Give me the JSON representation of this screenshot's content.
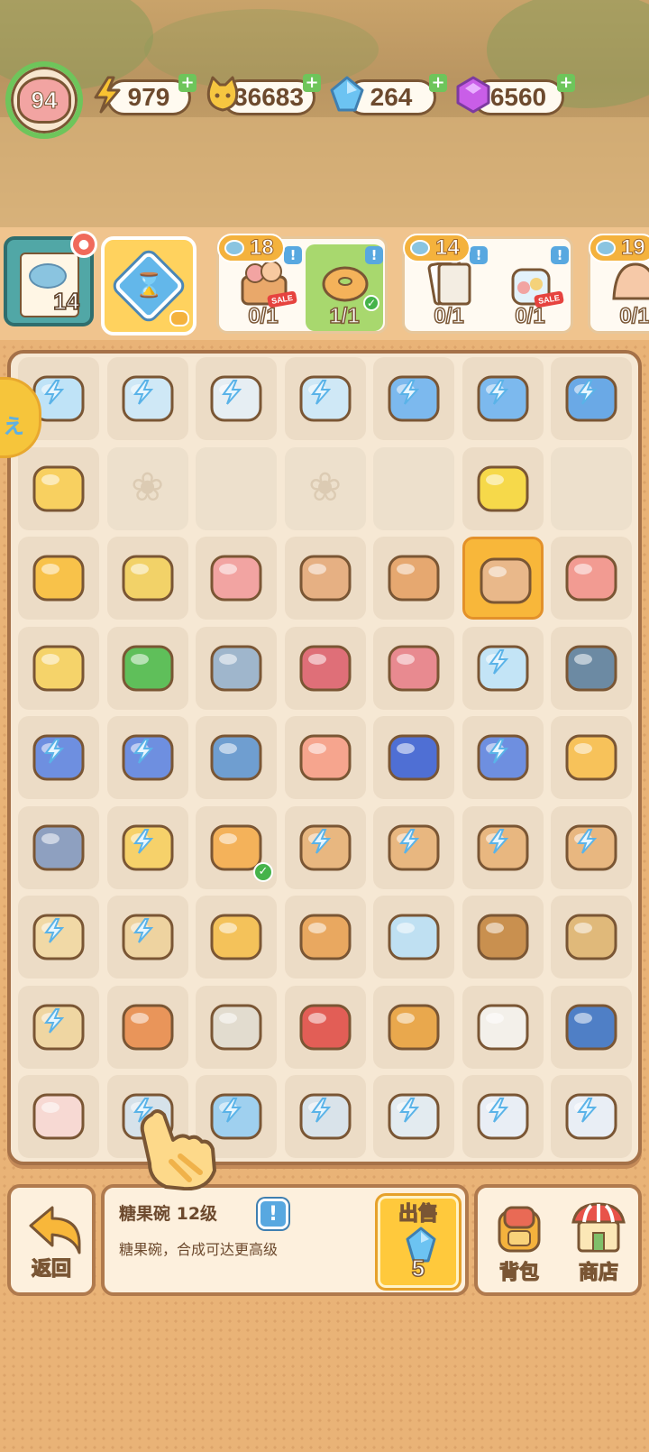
{
  "resources": {
    "level": "94",
    "energy": "979",
    "coins": "36683",
    "gems": "264",
    "crystals": "6560"
  },
  "order_book": {
    "count": "14"
  },
  "orders": [
    {
      "reward": "18",
      "slots": [
        {
          "count": "0/1",
          "item": "gift-basket",
          "sale": "SALE"
        },
        {
          "count": "1/1",
          "item": "donut",
          "done": true
        }
      ]
    },
    {
      "reward": "14",
      "slots": [
        {
          "count": "0/1",
          "item": "papers"
        },
        {
          "count": "0/1",
          "item": "candy-jar",
          "sale": "SALE"
        }
      ]
    },
    {
      "reward": "19",
      "slots": [
        {
          "count": "0/1",
          "item": "shell"
        }
      ]
    }
  ],
  "board": {
    "rows": [
      [
        "ice-cube",
        "open-fridge",
        "scale",
        "freezer",
        "toaster",
        "toaster",
        "open-toaster"
      ],
      [
        "gift-box",
        "empty",
        "empty",
        "empty",
        "empty",
        "lemons",
        "empty"
      ],
      [
        "orange-juice",
        "cat-cookies",
        "candy",
        "handbag",
        "purse",
        "candy-bowl",
        "lollipop"
      ],
      [
        "cat-bread",
        "energy-orb",
        "book-old",
        "book-red",
        "notebook",
        "ice-box",
        "ladle"
      ],
      [
        "sponge-tray",
        "sponge-tray",
        "blue-book",
        "cocktail",
        "blue-tray",
        "sponge-tray",
        "bubble-tea"
      ],
      [
        "fly-swatter",
        "tea-set-plate",
        "donut",
        "pot-mug",
        "pot-mug",
        "pot-mug",
        "pot-mug"
      ],
      [
        "shelf-box",
        "shelf-rack",
        "roll-cake",
        "pudding",
        "lunchbox",
        "spatula",
        "chopsticks"
      ],
      [
        "dish-rack",
        "leaf",
        "plate-spoon",
        "tongs",
        "peeler",
        "spoon",
        "tablet"
      ],
      [
        "bunny",
        "baking-tray",
        "steam-pot",
        "pot",
        "saucepan",
        "teapot-set",
        "teapot-set"
      ]
    ],
    "locked": [
      [
        0,
        0
      ],
      [
        0,
        1
      ],
      [
        0,
        2
      ],
      [
        0,
        3
      ],
      [
        0,
        4
      ],
      [
        0,
        5
      ],
      [
        0,
        6
      ],
      [
        3,
        5
      ],
      [
        4,
        0
      ],
      [
        4,
        1
      ],
      [
        4,
        5
      ],
      [
        5,
        1
      ],
      [
        5,
        3
      ],
      [
        5,
        4
      ],
      [
        5,
        5
      ],
      [
        5,
        6
      ],
      [
        6,
        0
      ],
      [
        6,
        1
      ],
      [
        7,
        0
      ],
      [
        8,
        1
      ],
      [
        8,
        2
      ],
      [
        8,
        3
      ],
      [
        8,
        4
      ],
      [
        8,
        5
      ],
      [
        8,
        6
      ]
    ],
    "selected": [
      2,
      5
    ]
  },
  "info": {
    "item_name": "糖果碗 12级",
    "description": "糖果碗，合成可达更高级"
  },
  "buttons": {
    "back": "返回",
    "sell": "出售",
    "sell_price": "5",
    "bag": "背包",
    "shop": "商店",
    "help": "!"
  },
  "colors": {
    "accent_green": "#6ec55b",
    "frame_brown": "#a57148",
    "selected_yellow": "#f8b73a",
    "gem_blue": "#63b7ea"
  }
}
